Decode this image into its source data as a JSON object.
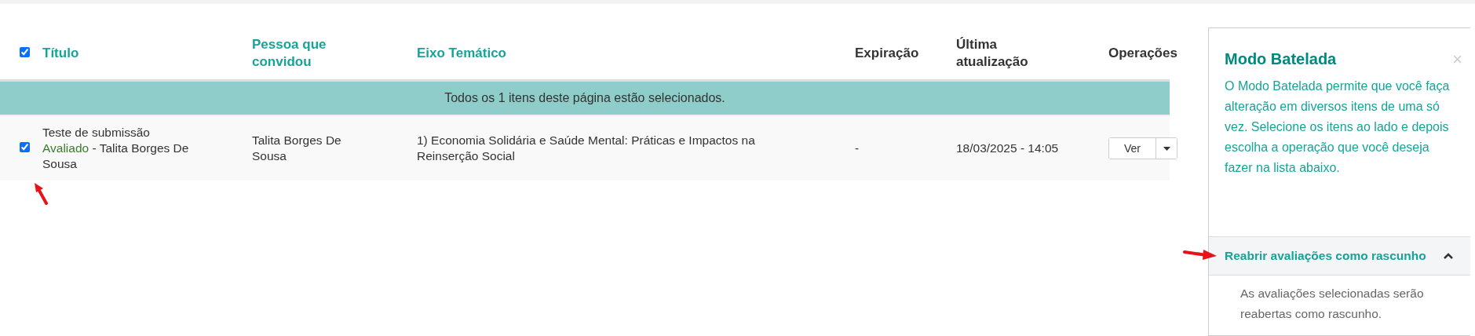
{
  "table": {
    "select_all": {
      "checked": true
    },
    "columns": [
      {
        "label": "Título",
        "kind": "link"
      },
      {
        "label": "Pessoa que convidou",
        "kind": "link"
      },
      {
        "label": "Eixo Temático",
        "kind": "link"
      },
      {
        "label": "Expiração",
        "kind": "plain"
      },
      {
        "label": "Última atualização",
        "kind": "plain"
      },
      {
        "label": "Operações",
        "kind": "plain"
      }
    ],
    "selection_banner": "Todos os 1 itens deste página estão selecionados.",
    "rows": [
      {
        "checked": true,
        "title": "Teste de submissão",
        "status": "Avaliado",
        "author": "- Talita Borges De Sousa",
        "inviter": "Talita Borges De Sousa",
        "theme": "1) Economia Solidária e Saúde Mental: Práticas e Impactos na Reinserção Social",
        "expiration": "-",
        "updated": "18/03/2025 - 14:05",
        "action": "Ver"
      }
    ]
  },
  "batch_panel": {
    "title": "Modo Batelada",
    "close": "×",
    "description": "O Modo Batelada permite que você faça alteração em diversos itens de uma só vez. Selecione os itens ao lado e depois escolha a operação que você deseja fazer na lista abaixo.",
    "operations": [
      {
        "label": "Reabrir avaliações como rascunho",
        "expanded": true,
        "description": "As avaliações selecionadas serão reabertas como rascunho."
      }
    ]
  }
}
